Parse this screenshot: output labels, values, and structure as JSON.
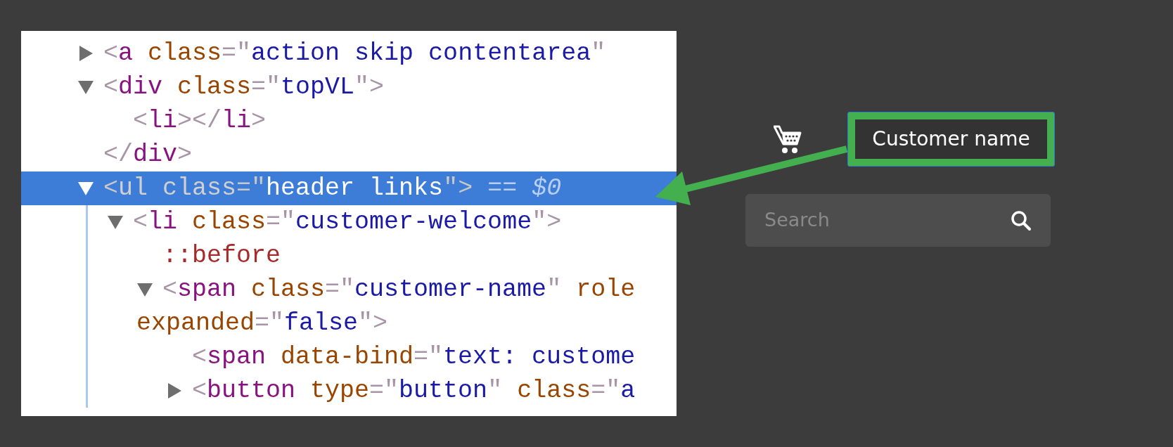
{
  "elements_tree": [
    {
      "expanded": false,
      "selected": false,
      "lines": [
        [
          {
            "kind": "punct",
            "text": "<"
          },
          {
            "kind": "tag",
            "text": "a"
          },
          {
            "kind": "attr",
            "text": " class"
          },
          {
            "kind": "punct",
            "text": "=\""
          },
          {
            "kind": "value",
            "text": "action skip contentarea"
          },
          {
            "kind": "punct",
            "text": "\""
          }
        ]
      ]
    },
    {
      "expanded": true,
      "selected": false,
      "lines": [
        [
          {
            "kind": "punct",
            "text": "<"
          },
          {
            "kind": "tag",
            "text": "div"
          },
          {
            "kind": "attr",
            "text": " class"
          },
          {
            "kind": "punct",
            "text": "=\""
          },
          {
            "kind": "value",
            "text": "topVL"
          },
          {
            "kind": "punct",
            "text": "\">"
          }
        ]
      ],
      "children": [
        {
          "selected": false,
          "lines": [
            [
              {
                "kind": "punct",
                "text": "<"
              },
              {
                "kind": "tag",
                "text": "li"
              },
              {
                "kind": "punct",
                "text": "></"
              },
              {
                "kind": "tag",
                "text": "li"
              },
              {
                "kind": "punct",
                "text": ">"
              }
            ]
          ]
        }
      ],
      "closing": [
        {
          "kind": "punct",
          "text": "</"
        },
        {
          "kind": "tag",
          "text": "div"
        },
        {
          "kind": "punct",
          "text": ">"
        }
      ]
    },
    {
      "expanded": true,
      "selected": true,
      "lines": [
        [
          {
            "kind": "punct",
            "text": "<"
          },
          {
            "kind": "tag",
            "text": "ul"
          },
          {
            "kind": "attr",
            "text": " class"
          },
          {
            "kind": "punct",
            "text": "=\""
          },
          {
            "kind": "value",
            "text": "header links"
          },
          {
            "kind": "punct",
            "text": "\">"
          },
          {
            "kind": "ref",
            "text": " == "
          },
          {
            "kind": "ref_var",
            "text": "$0"
          }
        ]
      ],
      "children": [
        {
          "expanded": true,
          "selected": false,
          "lines": [
            [
              {
                "kind": "punct",
                "text": "<"
              },
              {
                "kind": "tag",
                "text": "li"
              },
              {
                "kind": "attr",
                "text": " class"
              },
              {
                "kind": "punct",
                "text": "=\""
              },
              {
                "kind": "value",
                "text": "customer-welcome"
              },
              {
                "kind": "punct",
                "text": "\">"
              }
            ]
          ],
          "children": [
            {
              "selected": false,
              "lines": [
                [
                  {
                    "kind": "pseudo",
                    "text": "::before"
                  }
                ]
              ]
            },
            {
              "expanded": true,
              "selected": false,
              "lines": [
                [
                  {
                    "kind": "punct",
                    "text": "<"
                  },
                  {
                    "kind": "tag",
                    "text": "span"
                  },
                  {
                    "kind": "attr",
                    "text": " class"
                  },
                  {
                    "kind": "punct",
                    "text": "=\""
                  },
                  {
                    "kind": "value",
                    "text": "customer-name"
                  },
                  {
                    "kind": "punct",
                    "text": "\""
                  },
                  {
                    "kind": "attr",
                    "text": " role"
                  }
                ],
                [
                  {
                    "kind": "attr",
                    "text": "expanded"
                  },
                  {
                    "kind": "punct",
                    "text": "=\""
                  },
                  {
                    "kind": "value",
                    "text": "false"
                  },
                  {
                    "kind": "punct",
                    "text": "\">"
                  }
                ]
              ],
              "children": [
                {
                  "selected": false,
                  "lines": [
                    [
                      {
                        "kind": "punct",
                        "text": "<"
                      },
                      {
                        "kind": "tag",
                        "text": "span"
                      },
                      {
                        "kind": "attr",
                        "text": " data-bind"
                      },
                      {
                        "kind": "punct",
                        "text": "=\""
                      },
                      {
                        "kind": "value",
                        "text": "text: custome"
                      }
                    ]
                  ]
                },
                {
                  "expanded": false,
                  "selected": false,
                  "lines": [
                    [
                      {
                        "kind": "punct",
                        "text": "<"
                      },
                      {
                        "kind": "tag",
                        "text": "button"
                      },
                      {
                        "kind": "attr",
                        "text": " type"
                      },
                      {
                        "kind": "punct",
                        "text": "=\""
                      },
                      {
                        "kind": "value",
                        "text": "button"
                      },
                      {
                        "kind": "punct",
                        "text": "\""
                      },
                      {
                        "kind": "attr",
                        "text": " class"
                      },
                      {
                        "kind": "punct",
                        "text": "=\""
                      },
                      {
                        "kind": "value",
                        "text": "a"
                      }
                    ]
                  ]
                }
              ]
            }
          ]
        }
      ]
    }
  ],
  "header": {
    "customer_name": "Customer name",
    "search": {
      "placeholder": "Search"
    }
  }
}
